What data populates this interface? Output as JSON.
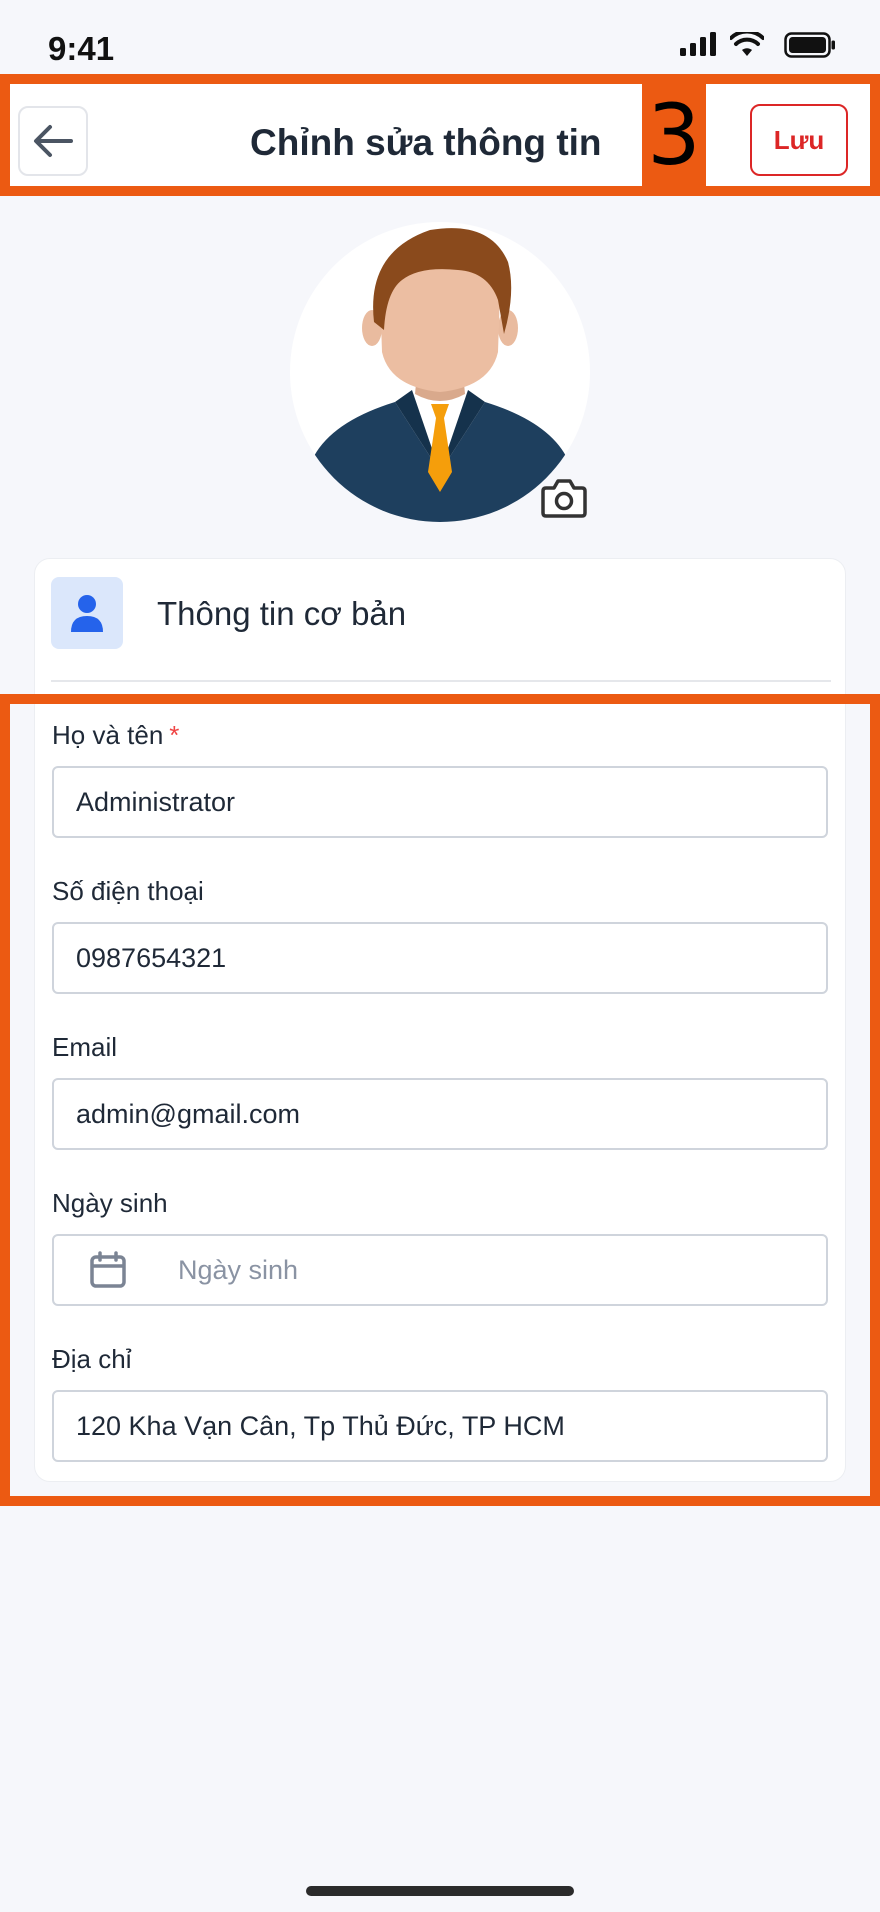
{
  "status_bar": {
    "time": "9:41"
  },
  "header": {
    "title": "Chỉnh sửa thông tin",
    "step_badge": "3",
    "save_label": "Lưu"
  },
  "section": {
    "title": "Thông tin cơ bản"
  },
  "form": {
    "full_name": {
      "label": "Họ và tên",
      "required_mark": "*",
      "value": "Administrator"
    },
    "phone": {
      "label": "Số điện thoại",
      "value": "0987654321"
    },
    "email": {
      "label": "Email",
      "value": "admin@gmail.com"
    },
    "birthday": {
      "label": "Ngày sinh",
      "placeholder": "Ngày sinh"
    },
    "address": {
      "label": "Địa chỉ",
      "value": "120 Kha Vạn Cân, Tp Thủ Đức, TP HCM"
    }
  },
  "icons": {
    "back": "arrow-left-icon",
    "camera": "camera-icon",
    "user": "user-icon",
    "calendar": "calendar-icon"
  },
  "colors": {
    "highlight_frame": "#ec5a12",
    "save_accent": "#dc2626",
    "section_icon_bg": "#dbe7fb",
    "section_icon": "#2563eb"
  }
}
